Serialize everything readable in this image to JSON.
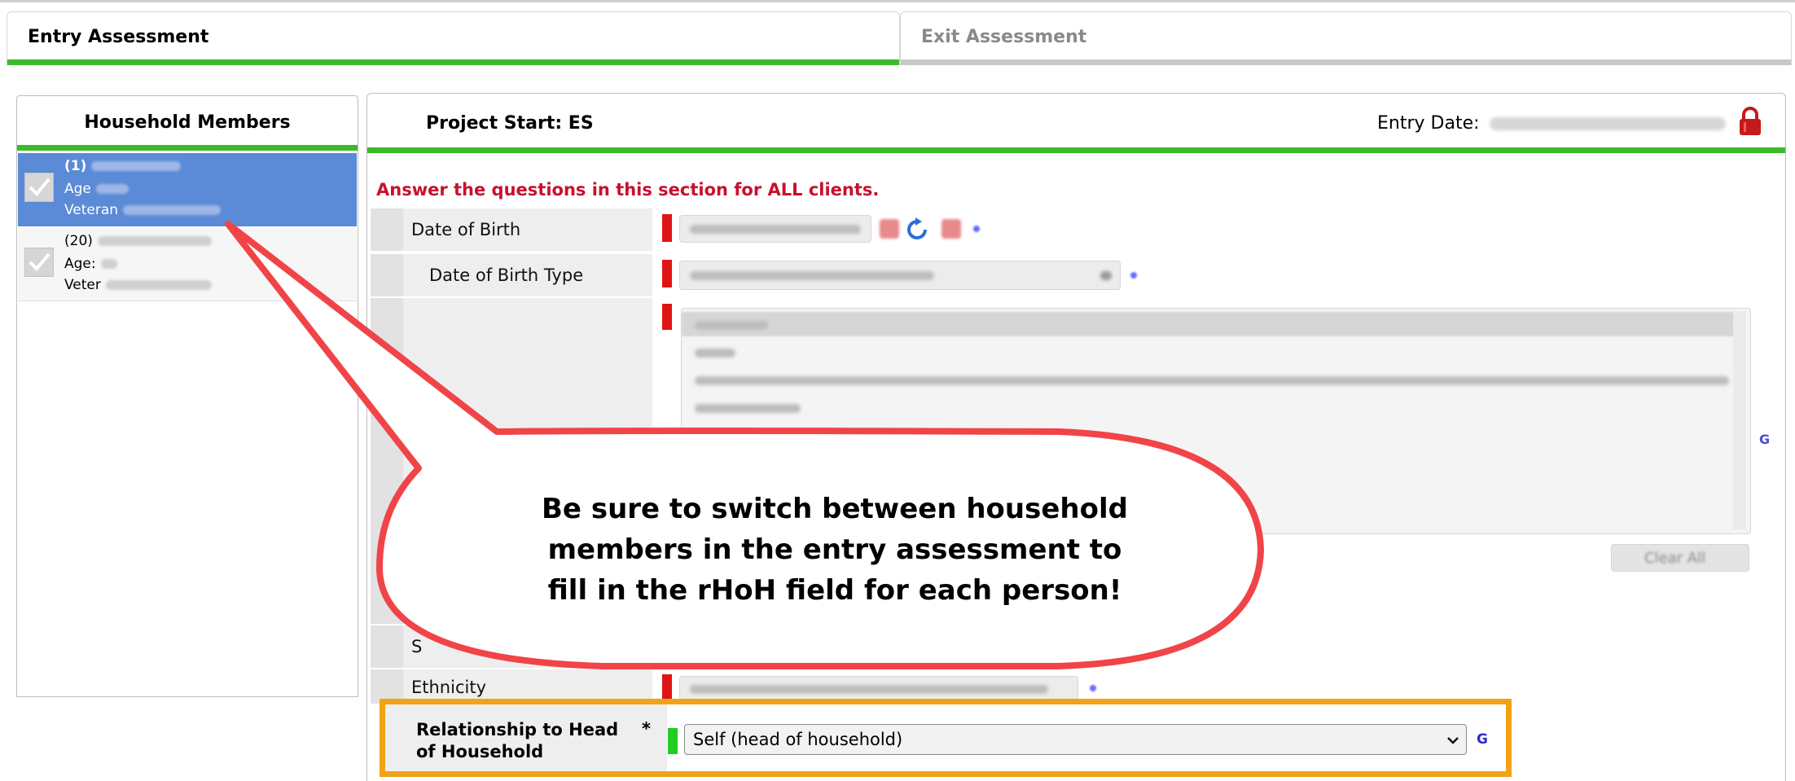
{
  "tabs": {
    "entry": "Entry Assessment",
    "exit": "Exit Assessment"
  },
  "household": {
    "title": "Household Members",
    "members": [
      {
        "number": "(1)",
        "age_label": "Age",
        "veteran_label": "Veteran"
      },
      {
        "number": "(20)",
        "age_label": "Age:",
        "veteran_label": "Veter"
      }
    ]
  },
  "project": {
    "title": "Project Start: ES",
    "entry_date_label": "Entry Date:",
    "instruction": "Answer the questions in this section for ALL clients."
  },
  "fields": {
    "dob_label": "Date of Birth",
    "dob_type_label": "Date of Birth Type",
    "clear_all": "Clear All",
    "ethnicity_label": "Ethnicity",
    "partial_label": "S",
    "relationship_label_line1": "Relationship to Head",
    "relationship_label_line2": "of Household",
    "relationship_required": "*",
    "relationship_value": "Self (head of household)",
    "g_icon": "G"
  },
  "callout": {
    "line1": "Be sure to switch between household",
    "line2": "members in the entry assessment to",
    "line3": "fill in the rHoH field for each person!",
    "color_stroke": "#f04448",
    "color_fill": "#ffffff"
  },
  "colors": {
    "green": "#3cba2c",
    "selected": "#5b8ad6",
    "required": "#e01414",
    "highlight": "#f0a316",
    "instruction": "#c8102e"
  }
}
